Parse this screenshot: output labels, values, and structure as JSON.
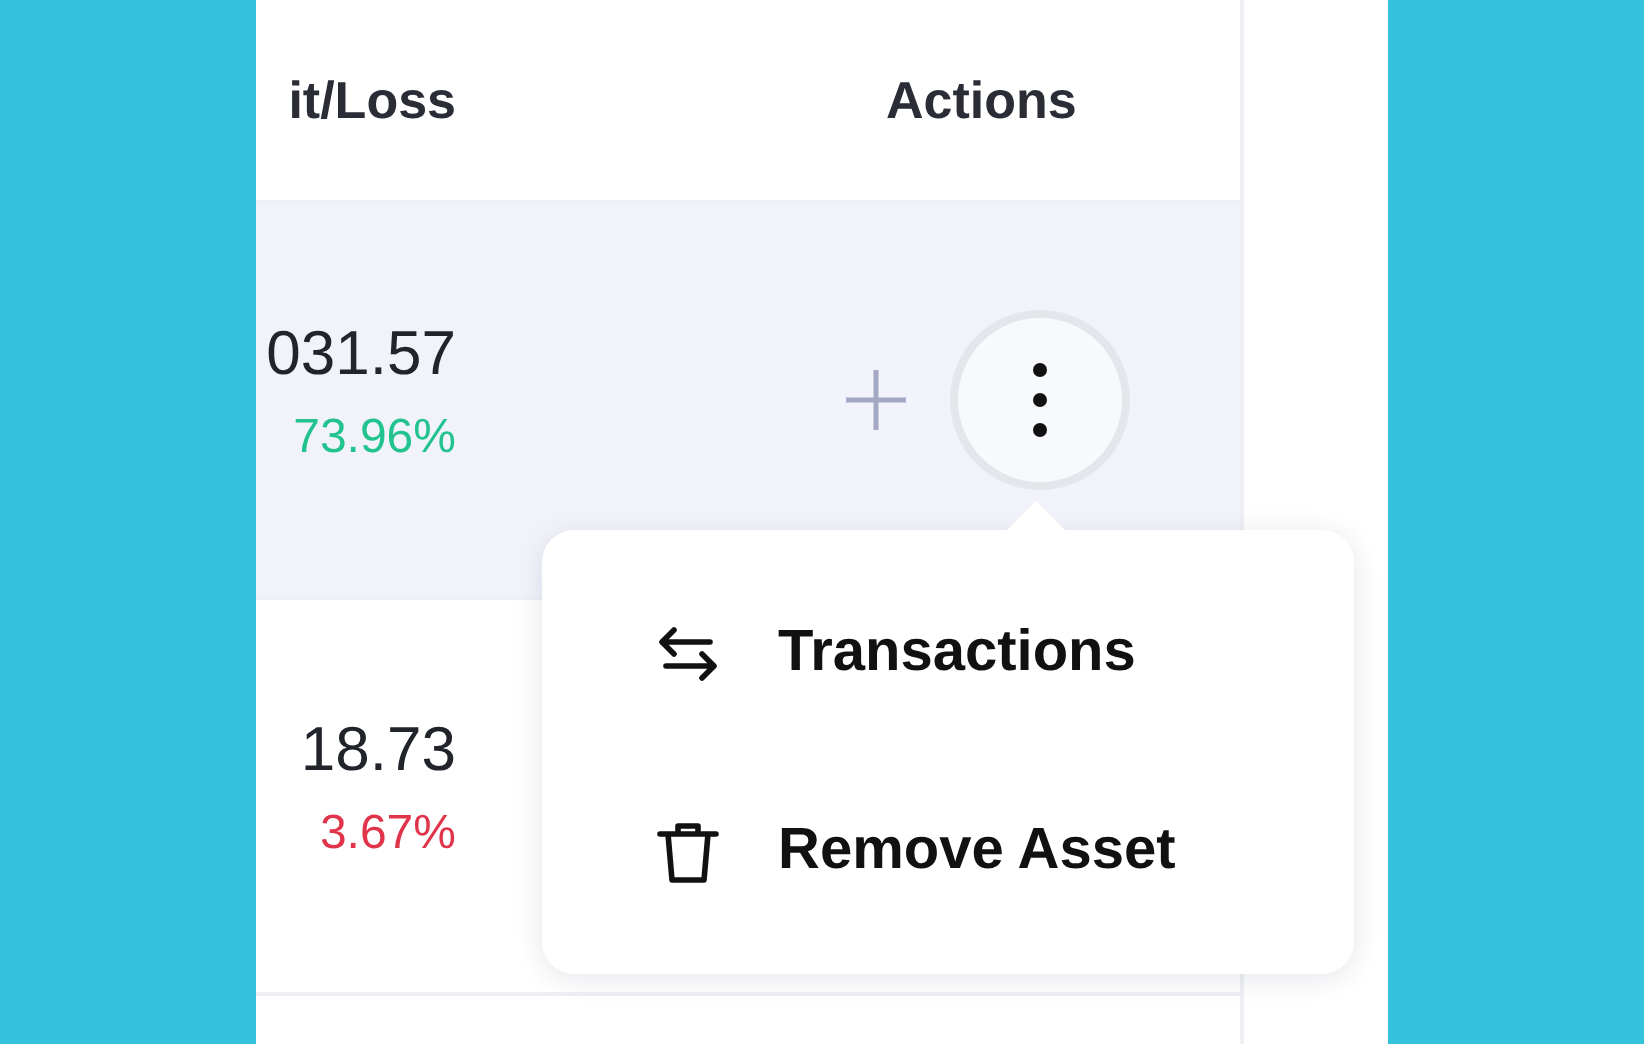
{
  "table": {
    "columns": [
      "it/Loss",
      "Actions"
    ],
    "rows": [
      {
        "profit": "031.57",
        "change": "73.96%",
        "color": "#22c38e",
        "highlighted": true
      },
      {
        "profit": "18.73",
        "change": "3.67%",
        "color": "#e0344a",
        "highlighted": false
      }
    ]
  },
  "actions_menu": {
    "open": true,
    "items": [
      {
        "kind": "swap",
        "label": "Transactions"
      },
      {
        "kind": "trash",
        "label": "Remove Asset"
      }
    ]
  }
}
